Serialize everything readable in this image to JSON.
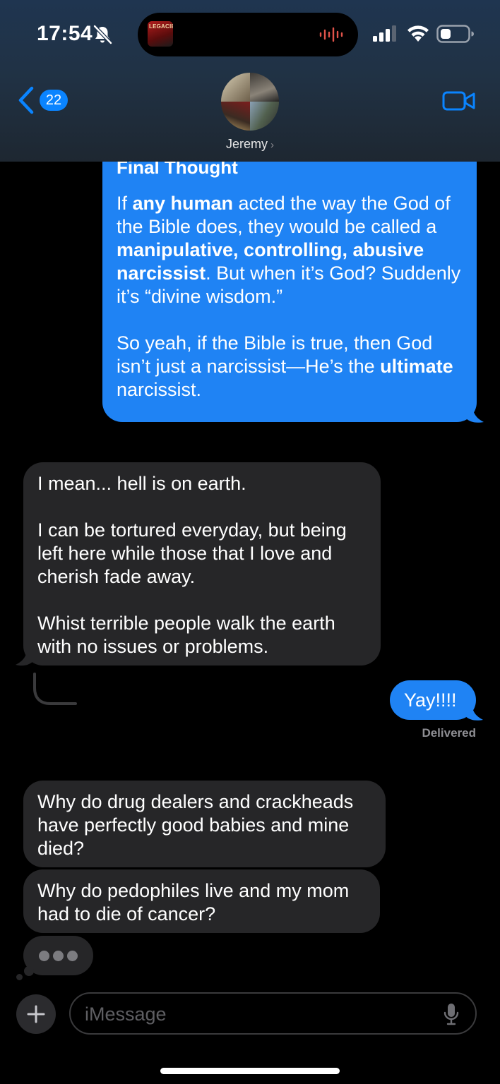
{
  "status_bar": {
    "time": "17:54",
    "live_activity_album_text": "LEGACIES",
    "icons": [
      "bell-slash",
      "waveform",
      "cellular-signal",
      "wifi",
      "battery"
    ]
  },
  "header": {
    "back_badge_count": "22",
    "contact_name": "Jeremy",
    "contact_chevron": "›",
    "icons": [
      "chevron-left",
      "video-camera"
    ]
  },
  "messages": {
    "final_thought": {
      "title": "Final Thought",
      "p1_a": "If ",
      "p1_b": "any human",
      "p1_c": " acted the way the God of the Bible does, they would be called a ",
      "p1_d": "manipulative, controlling, abusive narcissist",
      "p1_e": ". But when it’s God? Suddenly it’s “divine wisdom.”",
      "p2_a": "So yeah, if the Bible is true, then God isn’t just a narcissist—He’s the ",
      "p2_b": "ultimate",
      "p2_c": " narcissist."
    },
    "hell_on_earth": "I mean... hell is on earth.\n\nI can be tortured everyday, but being left here while those that I love and cherish fade away.\n\nWhist terrible people walk the earth with no issues or problems.",
    "yay": "Yay!!!!",
    "delivered": "Delivered",
    "drug_dealers": "Why do drug dealers and crackheads have perfectly good babies and mine died?",
    "pedophiles": "Why do pedophiles live and my mom had to die of cancer?"
  },
  "input_bar": {
    "placeholder": "iMessage",
    "icons": [
      "plus",
      "microphone"
    ]
  },
  "colors": {
    "sent_bubble": "#1f83f4",
    "received_bubble": "#262628",
    "accent": "#0a84ff",
    "background": "#000000"
  }
}
